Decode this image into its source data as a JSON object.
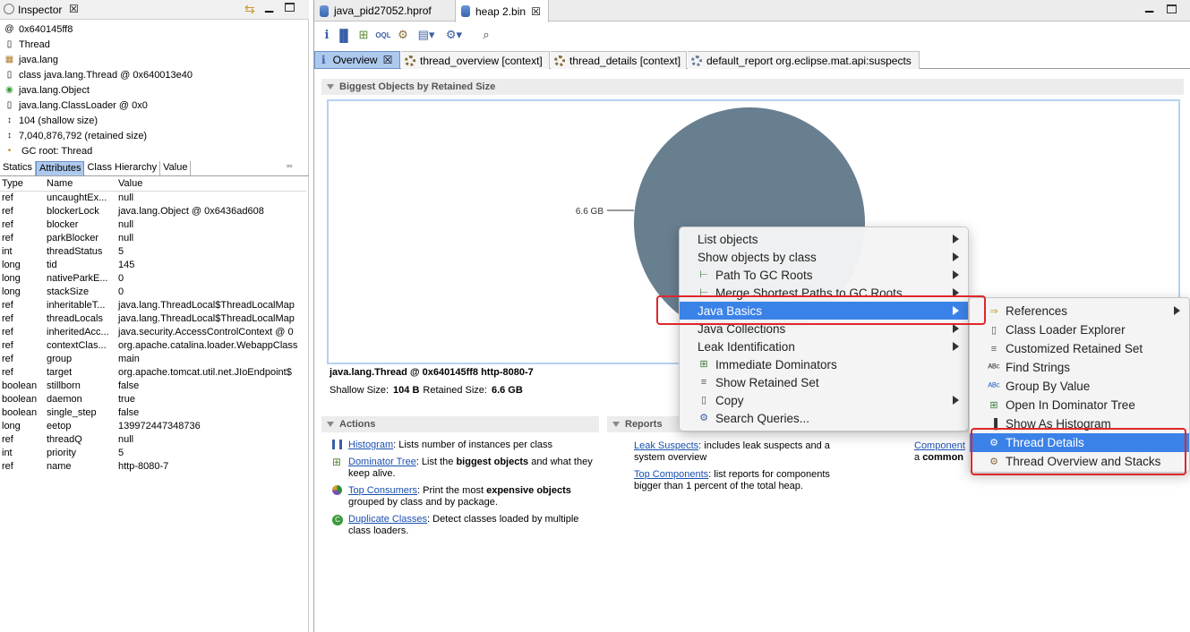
{
  "inspector": {
    "title": "Inspector",
    "info": [
      {
        "icon": "at-icon",
        "text": "0x640145ff8"
      },
      {
        "icon": "file-icon",
        "text": "Thread"
      },
      {
        "icon": "package-icon",
        "text": "java.lang"
      },
      {
        "icon": "class-icon",
        "text": "class java.lang.Thread @ 0x640013e40"
      },
      {
        "icon": "superclass-icon",
        "text": "java.lang.Object"
      },
      {
        "icon": "classloader-icon",
        "text": "java.lang.ClassLoader @ 0x0"
      },
      {
        "icon": "size-icon",
        "text": "104 (shallow size)"
      },
      {
        "icon": "size-icon",
        "text": "7,040,876,792 (retained size)"
      },
      {
        "icon": "gc-root-icon",
        "text": "GC root: Thread"
      }
    ],
    "tabs": [
      "Statics",
      "Attributes",
      "Class Hierarchy",
      "Value"
    ],
    "active_tab": "Attributes",
    "columns": [
      "Type",
      "Name",
      "Value"
    ],
    "rows": [
      [
        "ref",
        "uncaughtEx...",
        "null"
      ],
      [
        "ref",
        "blockerLock",
        "java.lang.Object @ 0x6436ad608"
      ],
      [
        "ref",
        "blocker",
        "null"
      ],
      [
        "ref",
        "parkBlocker",
        "null"
      ],
      [
        "int",
        "threadStatus",
        "5"
      ],
      [
        "long",
        "tid",
        "145"
      ],
      [
        "long",
        "nativeParkE...",
        "0"
      ],
      [
        "long",
        "stackSize",
        "0"
      ],
      [
        "ref",
        "inheritableT...",
        "java.lang.ThreadLocal$ThreadLocalMap"
      ],
      [
        "ref",
        "threadLocals",
        "java.lang.ThreadLocal$ThreadLocalMap"
      ],
      [
        "ref",
        "inheritedAcc...",
        "java.security.AccessControlContext @ 0"
      ],
      [
        "ref",
        "contextClas...",
        "org.apache.catalina.loader.WebappClass"
      ],
      [
        "ref",
        "group",
        "main"
      ],
      [
        "ref",
        "target",
        "org.apache.tomcat.util.net.JIoEndpoint$"
      ],
      [
        "boolean",
        "stillborn",
        "false"
      ],
      [
        "boolean",
        "daemon",
        "true"
      ],
      [
        "boolean",
        "single_step",
        "false"
      ],
      [
        "long",
        "eetop",
        "139972447348736"
      ],
      [
        "ref",
        "threadQ",
        "null"
      ],
      [
        "int",
        "priority",
        "5"
      ],
      [
        "ref",
        "name",
        "http-8080-7"
      ]
    ]
  },
  "editor": {
    "file_tabs": [
      "java_pid27052.hprof",
      "heap 2.bin"
    ],
    "active_file_tab": "heap 2.bin",
    "view_tabs": [
      "Overview",
      "thread_overview [context]",
      "thread_details [context]",
      "default_report  org.eclipse.mat.api:suspects"
    ],
    "biggest_objects_header": "Biggest Objects by Retained Size",
    "selected_object": "java.lang.Thread @ 0x640145ff8 http-8080-7",
    "shallow_label": "Shallow Size:",
    "shallow_value": "104 B",
    "retained_label": "Retained Size:",
    "retained_value": "6.6 GB",
    "actions_header": "Actions",
    "reports_header": "Reports",
    "actions": [
      {
        "link": "Histogram",
        "pre": ": Lists number of instances per class",
        "bold": "",
        "post": ""
      },
      {
        "link": "Dominator Tree",
        "pre": ": List the ",
        "bold": "biggest objects",
        "post": " and what they keep alive."
      },
      {
        "link": "Top Consumers",
        "pre": ": Print the most ",
        "bold": "expensive objects",
        "post": " grouped by class and by package."
      },
      {
        "link": "Duplicate Classes",
        "pre": ": Detect classes loaded by multiple class loaders.",
        "bold": "",
        "post": ""
      }
    ],
    "reports": [
      {
        "link": "Leak Suspects",
        "text": ": includes leak suspects and a system overview"
      },
      {
        "link": "Top Components",
        "text": ": list reports for components bigger than 1 percent of the total heap."
      }
    ],
    "component_link": "Component",
    "component_text_a": "a ",
    "component_text_b": "common"
  },
  "chart_data": {
    "type": "pie",
    "slices": [
      {
        "label": "6.6 GB",
        "value": 6.6,
        "color": "#687f90"
      }
    ],
    "title": ""
  },
  "context_menu": {
    "items": [
      {
        "label": "List objects",
        "submenu": true,
        "icon": ""
      },
      {
        "label": "Show objects by class",
        "submenu": true,
        "icon": ""
      },
      {
        "label": "Path To GC Roots",
        "submenu": true,
        "icon": "path-icon"
      },
      {
        "label": "Merge Shortest Paths to GC Roots",
        "submenu": true,
        "icon": "merge-icon"
      },
      {
        "label": "Java Basics",
        "submenu": true,
        "icon": "",
        "highlighted": true
      },
      {
        "label": "Java Collections",
        "submenu": true,
        "icon": ""
      },
      {
        "label": "Leak Identification",
        "submenu": true,
        "icon": ""
      },
      {
        "label": "Immediate Dominators",
        "submenu": false,
        "icon": "dominator-icon"
      },
      {
        "label": "Show Retained Set",
        "submenu": false,
        "icon": "retained-set-icon"
      },
      {
        "label": "Copy",
        "submenu": true,
        "icon": "copy-icon"
      },
      {
        "label": "Search Queries...",
        "submenu": false,
        "icon": "search-queries-icon"
      }
    ]
  },
  "sub_menu": {
    "items": [
      {
        "label": "References",
        "submenu": true,
        "icon": "arrow-ref-icon"
      },
      {
        "label": "Class Loader Explorer",
        "submenu": false,
        "icon": "classloader-icon"
      },
      {
        "label": "Customized Retained Set",
        "submenu": false,
        "icon": "retained-set-icon"
      },
      {
        "label": "Find Strings",
        "submenu": false,
        "icon": "abc-icon"
      },
      {
        "label": "Group By Value",
        "submenu": false,
        "icon": "abc-blue-icon"
      },
      {
        "label": "Open In Dominator Tree",
        "submenu": false,
        "icon": "dominator-icon"
      },
      {
        "label": "Show As Histogram",
        "submenu": false,
        "icon": "histogram-icon"
      },
      {
        "label": "Thread Details",
        "submenu": false,
        "icon": "gear-icon",
        "highlighted": true
      },
      {
        "label": "Thread Overview and Stacks",
        "submenu": false,
        "icon": "gear-icon"
      }
    ]
  },
  "colors": {
    "accent": "#3b82e8",
    "annotation": "#e0262a",
    "pie": "#687f90",
    "link": "#1a4fb0"
  }
}
